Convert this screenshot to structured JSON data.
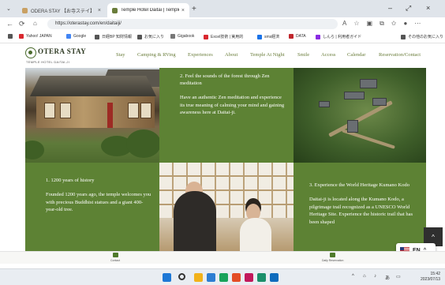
{
  "browser": {
    "tabs": [
      {
        "title": "ODERA STAY 【お寺ステイ】",
        "close": "×",
        "icon_color": "#c9a063"
      },
      {
        "title": "Temple Hotel Daitai | Temple Wa",
        "close": "×",
        "icon_color": "#6a7d3b"
      }
    ],
    "new_tab": "+",
    "window_controls": [
      "–",
      "⤢",
      "×"
    ],
    "url": "https://oterastay.com/en/daitaiji/",
    "bookmarks": [
      {
        "label": "Yahoo! JAPAN",
        "color": "#d9282f"
      },
      {
        "label": "Google",
        "color": "#4285f4"
      },
      {
        "label": "日経BP 知財情報",
        "color": "#555555"
      },
      {
        "label": "お気に入り",
        "color": "#555555"
      },
      {
        "label": "Gigabook",
        "color": "#777777"
      },
      {
        "label": "Excel技術 | 実用的",
        "color": "#d9282f"
      },
      {
        "label": "sms経済",
        "color": "#1a73e8"
      },
      {
        "label": "DATA",
        "color": "#c0272d"
      },
      {
        "label": "しんら | 利用者ガイド",
        "color": "#8a2be2"
      },
      {
        "label": "その他のお気に入り",
        "color": "#555555"
      }
    ]
  },
  "site": {
    "logo": {
      "name": "OTERA STAY",
      "tagline": "TEMPLE HOTEL DAITAI-JI"
    },
    "nav": [
      "Stay",
      "Camping & RVing",
      "Experiences",
      "About",
      "Temple At Night",
      "Smile",
      "Access",
      "Calendar",
      "Reservation/Contact"
    ]
  },
  "panels": {
    "zen": {
      "heading": "2. Feel the sounds of the forest through Zen meditation",
      "body": "Have an authentic Zen meditation and experience its true meaning of calming your mind and gaining awareness here at Daitai-ji."
    },
    "history": {
      "heading": "1. 1200 years of history",
      "body": "Founded 1200 years ago, the temple welcomes you with precious Buddhist statues and a giant 400-year-old tree."
    },
    "kodo": {
      "heading": "3. Experience the World Heritage Kumano Kodo",
      "body": "Daitai-ji is located along the Kumano Kodo, a pilgrimage trail recognized as a UNESCO World Heritage Site. Experience the historic trail that has been shaped"
    }
  },
  "language": {
    "label": "EN",
    "caret": "^"
  },
  "back_to_top": "^",
  "footer": [
    {
      "label": "Contact"
    },
    {
      "label": "Daily Reservation"
    }
  ],
  "tray": {
    "caret": "^",
    "lang": "あ",
    "time": "15:42",
    "date": "2023/07/13"
  },
  "colors": {
    "accent_green": "#5d8234",
    "nav_green": "#6a7d3b"
  }
}
